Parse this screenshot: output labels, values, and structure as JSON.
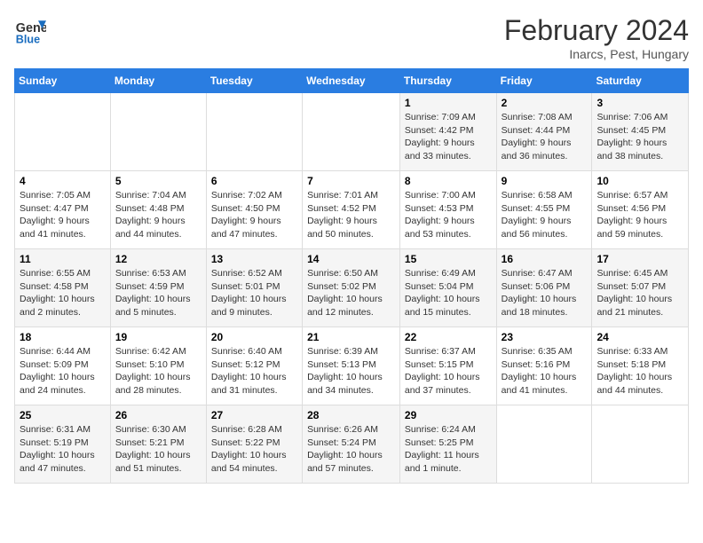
{
  "logo": {
    "line1": "General",
    "line2": "Blue"
  },
  "title": "February 2024",
  "subtitle": "Inarcs, Pest, Hungary",
  "days_header": [
    "Sunday",
    "Monday",
    "Tuesday",
    "Wednesday",
    "Thursday",
    "Friday",
    "Saturday"
  ],
  "weeks": [
    [
      {
        "num": "",
        "info": ""
      },
      {
        "num": "",
        "info": ""
      },
      {
        "num": "",
        "info": ""
      },
      {
        "num": "",
        "info": ""
      },
      {
        "num": "1",
        "info": "Sunrise: 7:09 AM\nSunset: 4:42 PM\nDaylight: 9 hours\nand 33 minutes."
      },
      {
        "num": "2",
        "info": "Sunrise: 7:08 AM\nSunset: 4:44 PM\nDaylight: 9 hours\nand 36 minutes."
      },
      {
        "num": "3",
        "info": "Sunrise: 7:06 AM\nSunset: 4:45 PM\nDaylight: 9 hours\nand 38 minutes."
      }
    ],
    [
      {
        "num": "4",
        "info": "Sunrise: 7:05 AM\nSunset: 4:47 PM\nDaylight: 9 hours\nand 41 minutes."
      },
      {
        "num": "5",
        "info": "Sunrise: 7:04 AM\nSunset: 4:48 PM\nDaylight: 9 hours\nand 44 minutes."
      },
      {
        "num": "6",
        "info": "Sunrise: 7:02 AM\nSunset: 4:50 PM\nDaylight: 9 hours\nand 47 minutes."
      },
      {
        "num": "7",
        "info": "Sunrise: 7:01 AM\nSunset: 4:52 PM\nDaylight: 9 hours\nand 50 minutes."
      },
      {
        "num": "8",
        "info": "Sunrise: 7:00 AM\nSunset: 4:53 PM\nDaylight: 9 hours\nand 53 minutes."
      },
      {
        "num": "9",
        "info": "Sunrise: 6:58 AM\nSunset: 4:55 PM\nDaylight: 9 hours\nand 56 minutes."
      },
      {
        "num": "10",
        "info": "Sunrise: 6:57 AM\nSunset: 4:56 PM\nDaylight: 9 hours\nand 59 minutes."
      }
    ],
    [
      {
        "num": "11",
        "info": "Sunrise: 6:55 AM\nSunset: 4:58 PM\nDaylight: 10 hours\nand 2 minutes."
      },
      {
        "num": "12",
        "info": "Sunrise: 6:53 AM\nSunset: 4:59 PM\nDaylight: 10 hours\nand 5 minutes."
      },
      {
        "num": "13",
        "info": "Sunrise: 6:52 AM\nSunset: 5:01 PM\nDaylight: 10 hours\nand 9 minutes."
      },
      {
        "num": "14",
        "info": "Sunrise: 6:50 AM\nSunset: 5:02 PM\nDaylight: 10 hours\nand 12 minutes."
      },
      {
        "num": "15",
        "info": "Sunrise: 6:49 AM\nSunset: 5:04 PM\nDaylight: 10 hours\nand 15 minutes."
      },
      {
        "num": "16",
        "info": "Sunrise: 6:47 AM\nSunset: 5:06 PM\nDaylight: 10 hours\nand 18 minutes."
      },
      {
        "num": "17",
        "info": "Sunrise: 6:45 AM\nSunset: 5:07 PM\nDaylight: 10 hours\nand 21 minutes."
      }
    ],
    [
      {
        "num": "18",
        "info": "Sunrise: 6:44 AM\nSunset: 5:09 PM\nDaylight: 10 hours\nand 24 minutes."
      },
      {
        "num": "19",
        "info": "Sunrise: 6:42 AM\nSunset: 5:10 PM\nDaylight: 10 hours\nand 28 minutes."
      },
      {
        "num": "20",
        "info": "Sunrise: 6:40 AM\nSunset: 5:12 PM\nDaylight: 10 hours\nand 31 minutes."
      },
      {
        "num": "21",
        "info": "Sunrise: 6:39 AM\nSunset: 5:13 PM\nDaylight: 10 hours\nand 34 minutes."
      },
      {
        "num": "22",
        "info": "Sunrise: 6:37 AM\nSunset: 5:15 PM\nDaylight: 10 hours\nand 37 minutes."
      },
      {
        "num": "23",
        "info": "Sunrise: 6:35 AM\nSunset: 5:16 PM\nDaylight: 10 hours\nand 41 minutes."
      },
      {
        "num": "24",
        "info": "Sunrise: 6:33 AM\nSunset: 5:18 PM\nDaylight: 10 hours\nand 44 minutes."
      }
    ],
    [
      {
        "num": "25",
        "info": "Sunrise: 6:31 AM\nSunset: 5:19 PM\nDaylight: 10 hours\nand 47 minutes."
      },
      {
        "num": "26",
        "info": "Sunrise: 6:30 AM\nSunset: 5:21 PM\nDaylight: 10 hours\nand 51 minutes."
      },
      {
        "num": "27",
        "info": "Sunrise: 6:28 AM\nSunset: 5:22 PM\nDaylight: 10 hours\nand 54 minutes."
      },
      {
        "num": "28",
        "info": "Sunrise: 6:26 AM\nSunset: 5:24 PM\nDaylight: 10 hours\nand 57 minutes."
      },
      {
        "num": "29",
        "info": "Sunrise: 6:24 AM\nSunset: 5:25 PM\nDaylight: 11 hours\nand 1 minute."
      },
      {
        "num": "",
        "info": ""
      },
      {
        "num": "",
        "info": ""
      }
    ]
  ]
}
